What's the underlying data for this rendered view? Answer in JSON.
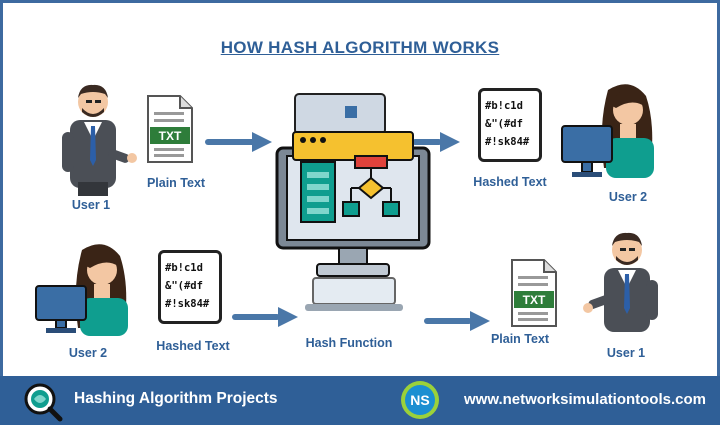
{
  "title": "HOW HASH ALGORITHM WORKS",
  "top_row": {
    "sender_label": "User 1",
    "input_label": "Plain Text",
    "input_file_ext": "TXT",
    "output_label": "Hashed Text",
    "output_hash_lines": [
      "#b!c1d",
      "&\"(#df",
      "#!sk84#"
    ],
    "receiver_label": "User 2"
  },
  "bottom_row": {
    "sender_label": "User 2",
    "input_label": "Hashed Text",
    "input_hash_lines": [
      "#b!c1d",
      "&\"(#df",
      "#!sk84#"
    ],
    "process_label": "Hash Function",
    "output_label": "Plain Text",
    "output_file_ext": "TXT",
    "receiver_label": "User 1"
  },
  "footer": {
    "project_label": "Hashing Algorithm Projects",
    "logo_text": "NS",
    "website": "www.networksimulationtools.com"
  },
  "colors": {
    "accent_blue": "#2f5f97",
    "arrow": "#4a77a8",
    "footer_bg": "#2f5f97",
    "file_green": "#2e7d3a",
    "monitor_yellow": "#f5c12f",
    "flow_teal": "#0f9e8f",
    "flow_red": "#e0423b"
  }
}
